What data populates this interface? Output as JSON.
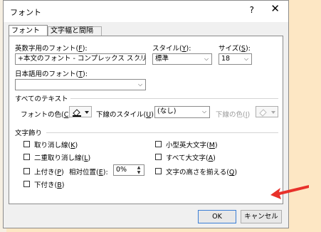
{
  "window": {
    "title": "フォント",
    "help": "?",
    "close": "✕"
  },
  "tabs": [
    {
      "label_pre": "フォント(",
      "key": "N",
      "label_post": ")"
    },
    {
      "label_pre": "文字幅と間隔(",
      "key": "R",
      "label_post": ")"
    }
  ],
  "latin_font": {
    "label_pre": "英数字用のフォント(",
    "key": "F",
    "label_post": "):",
    "value": "+本文のフォント - コンプレックス スクリプト"
  },
  "style": {
    "label_pre": "スタイル(",
    "key": "Y",
    "label_post": "):",
    "value": "標準"
  },
  "size": {
    "label_pre": "サイズ(",
    "key": "S",
    "label_post": "):",
    "value": "18"
  },
  "asian_font": {
    "label_pre": "日本語用のフォント(",
    "key": "T",
    "label_post": "):",
    "value": ""
  },
  "all_text": {
    "heading": "すべてのテキスト",
    "font_color_label_pre": "フォントの色(",
    "font_color_key": "C",
    "font_color_label_post": ")",
    "underline_style_label_pre": "下線のスタイル(",
    "underline_style_key": "U",
    "underline_style_label_post": ")",
    "underline_style_value": "(なし)",
    "underline_color_label_pre": "下線の色(",
    "underline_color_key": "I",
    "underline_color_label_post": ")"
  },
  "effects": {
    "heading": "文字飾り",
    "strikethrough": {
      "pre": "取り消し線(",
      "key": "K",
      "post": ")"
    },
    "double_strikethrough": {
      "pre": "二重取り消し線(",
      "key": "L",
      "post": ")"
    },
    "superscript": {
      "pre": "上付き(",
      "key": "P",
      "post": ")"
    },
    "offset": {
      "pre": "相対位置(",
      "key": "E",
      "post": "):",
      "value": "0%"
    },
    "subscript": {
      "pre": "下付き(",
      "key": "B",
      "post": ")"
    },
    "small_caps": {
      "pre": "小型英大文字(",
      "key": "M",
      "post": ")"
    },
    "all_caps": {
      "pre": "すべて大文字(",
      "key": "A",
      "post": ")"
    },
    "equalize_height": {
      "pre": "文字の高さを揃える(",
      "key": "Q",
      "post": ")"
    }
  },
  "buttons": {
    "ok": "OK",
    "cancel": "キャンセル"
  },
  "colors": {
    "arrow": "#e8312a",
    "background": "#fde7c4"
  }
}
